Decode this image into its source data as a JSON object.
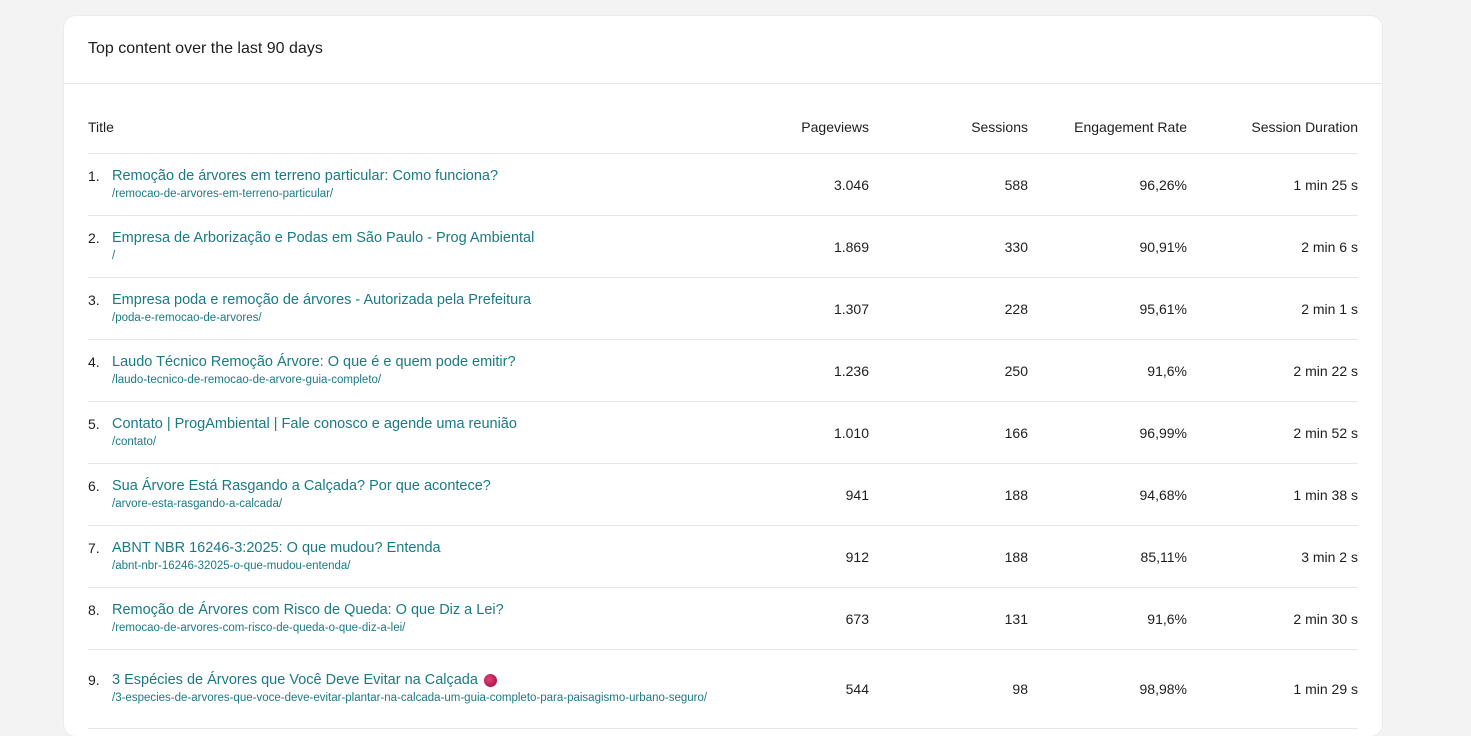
{
  "card": {
    "title": "Top content over the last 90 days"
  },
  "table": {
    "headers": {
      "title": "Title",
      "pageviews": "Pageviews",
      "sessions": "Sessions",
      "engagement": "Engagement Rate",
      "duration": "Session Duration"
    },
    "rows": [
      {
        "index": "1.",
        "title": "Remoção de árvores em terreno particular: Como funciona?",
        "path": "/remocao-de-arvores-em-terreno-particular/",
        "pageviews": "3.046",
        "sessions": "588",
        "engagement": "96,26%",
        "duration": "1 min 25 s"
      },
      {
        "index": "2.",
        "title": "Empresa de Arborização e Podas em São Paulo - Prog Ambiental",
        "path": "/",
        "pageviews": "1.869",
        "sessions": "330",
        "engagement": "90,91%",
        "duration": "2 min 6 s"
      },
      {
        "index": "3.",
        "title": "Empresa poda e remoção de árvores - Autorizada pela Prefeitura",
        "path": "/poda-e-remocao-de-arvores/",
        "pageviews": "1.307",
        "sessions": "228",
        "engagement": "95,61%",
        "duration": "2 min 1 s"
      },
      {
        "index": "4.",
        "title": "Laudo Técnico Remoção Árvore: O que é e quem pode emitir?",
        "path": "/laudo-tecnico-de-remocao-de-arvore-guia-completo/",
        "pageviews": "1.236",
        "sessions": "250",
        "engagement": "91,6%",
        "duration": "2 min 22 s"
      },
      {
        "index": "5.",
        "title": "Contato | ProgAmbiental | Fale conosco e agende uma reunião",
        "path": "/contato/",
        "pageviews": "1.010",
        "sessions": "166",
        "engagement": "96,99%",
        "duration": "2 min 52 s"
      },
      {
        "index": "6.",
        "title": "Sua Árvore Está Rasgando a Calçada? Por que acontece?",
        "path": "/arvore-esta-rasgando-a-calcada/",
        "pageviews": "941",
        "sessions": "188",
        "engagement": "94,68%",
        "duration": "1 min 38 s"
      },
      {
        "index": "7.",
        "title": "ABNT NBR 16246-3:2025: O que mudou? Entenda",
        "path": "/abnt-nbr-16246-32025-o-que-mudou-entenda/",
        "pageviews": "912",
        "sessions": "188",
        "engagement": "85,11%",
        "duration": "3 min 2 s"
      },
      {
        "index": "8.",
        "title": "Remoção de Árvores com Risco de Queda: O que Diz a Lei?",
        "path": "/remocao-de-arvores-com-risco-de-queda-o-que-diz-a-lei/",
        "pageviews": "673",
        "sessions": "131",
        "engagement": "91,6%",
        "duration": "2 min 30 s"
      },
      {
        "index": "9.",
        "title": "3 Espécies de Árvores que Você Deve Evitar na Calçada",
        "path": "/3-especies-de-arvores-que-voce-deve-evitar-plantar-na-calcada-um-guia-completo-para-paisagismo-urbano-seguro/",
        "pageviews": "544",
        "sessions": "98",
        "engagement": "98,98%",
        "duration": "1 min 29 s"
      }
    ]
  },
  "colors": {
    "link": "#1a7a84",
    "background": "#f3f3f3",
    "card": "#ffffff"
  },
  "icons": {
    "row9_emoji": "red-circle-icon"
  }
}
